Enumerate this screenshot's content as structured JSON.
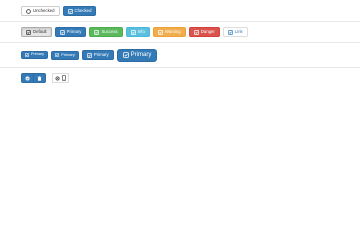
{
  "toggle_row": {
    "unchecked_label": "Unchecked",
    "checked_label": "Checked"
  },
  "colors_row": {
    "default_label": "Default",
    "primary_label": "Primary",
    "success_label": "Success",
    "info_label": "Info",
    "warning_label": "Warning",
    "danger_label": "Danger",
    "link_label": "Link"
  },
  "sizes_row": {
    "small_label": "Primary",
    "extra_small_label": "Primary",
    "medium_label": "Primary",
    "large_label": "Primary"
  },
  "icon_row": {
    "icons": [
      "check-icon",
      "trash-icon",
      "gear-icon",
      "mobile-icon"
    ]
  },
  "colors": {
    "primary": "#337ab7",
    "success": "#5cb85c",
    "info": "#5bc0de",
    "warning": "#f0ad4e",
    "danger": "#d9534f"
  }
}
